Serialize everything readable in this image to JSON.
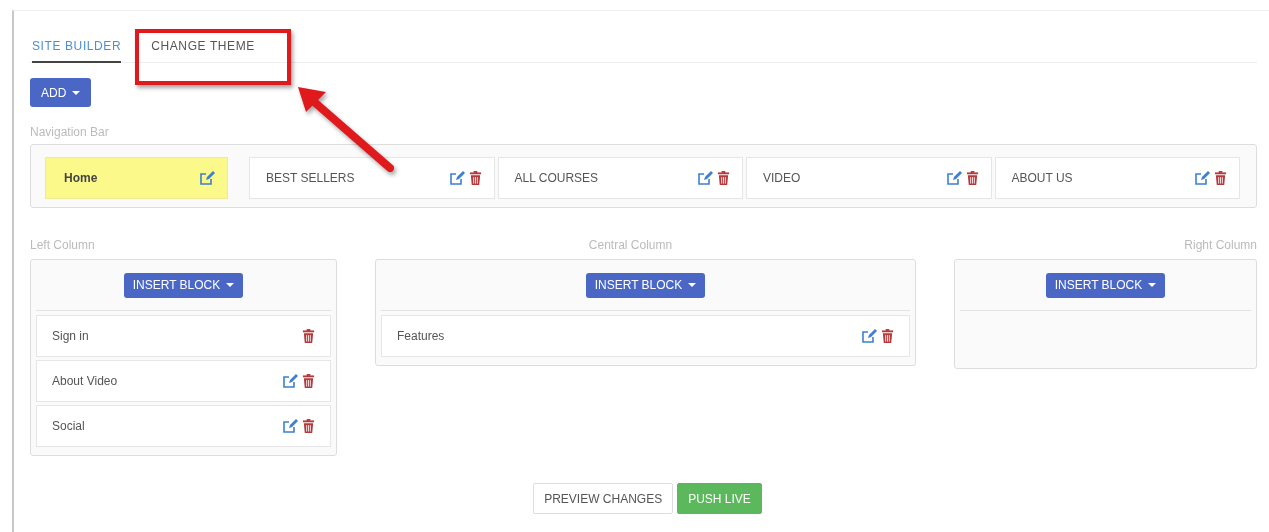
{
  "tabs": [
    {
      "label": "SITE BUILDER",
      "selected": true
    },
    {
      "label": "CHANGE THEME",
      "selected": false
    }
  ],
  "add_button": "ADD",
  "navigation_bar": {
    "label": "Navigation Bar",
    "items": [
      {
        "label": "Home",
        "selected": true,
        "editable": true,
        "deletable": false
      },
      {
        "label": "BEST SELLERS",
        "selected": false,
        "editable": true,
        "deletable": true
      },
      {
        "label": "ALL COURSES",
        "selected": false,
        "editable": true,
        "deletable": true
      },
      {
        "label": "VIDEO",
        "selected": false,
        "editable": true,
        "deletable": true
      },
      {
        "label": "ABOUT US",
        "selected": false,
        "editable": true,
        "deletable": true
      }
    ]
  },
  "columns": [
    {
      "label": "Left Column",
      "button": "INSERT BLOCK",
      "blocks": [
        {
          "label": "Sign in",
          "editable": false,
          "deletable": true
        },
        {
          "label": "About Video",
          "editable": true,
          "deletable": true
        },
        {
          "label": "Social",
          "editable": true,
          "deletable": true
        }
      ]
    },
    {
      "label": "Central Column",
      "button": "INSERT BLOCK",
      "blocks": [
        {
          "label": "Features",
          "editable": true,
          "deletable": true
        }
      ]
    },
    {
      "label": "Right Column",
      "button": "INSERT BLOCK"
    }
  ],
  "footer_buttons": [
    {
      "label": "PREVIEW CHANGES",
      "kind": "default"
    },
    {
      "label": "PUSH LIVE",
      "kind": "success"
    }
  ]
}
